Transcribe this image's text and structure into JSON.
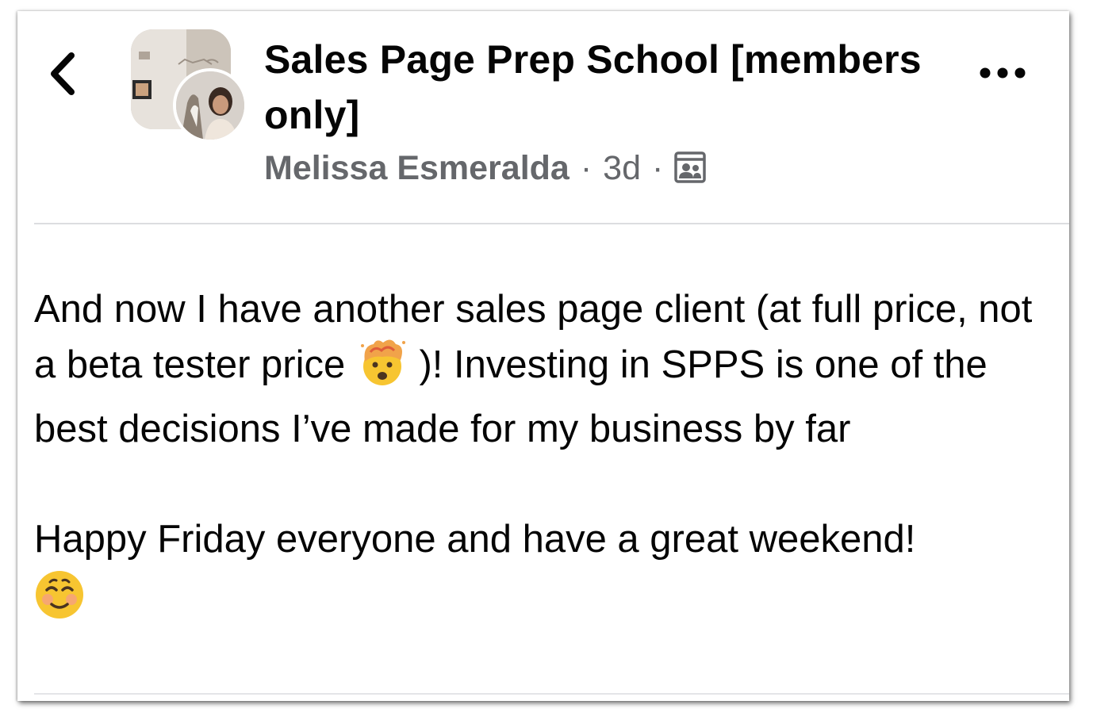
{
  "header": {
    "group_name": "Sales Page Prep School [members only]",
    "author": "Melissa Esmeralda",
    "separator": "·",
    "time_ago": "3d",
    "privacy_icon": "group-members-icon"
  },
  "navigation": {
    "back_icon": "chevron-left-icon",
    "more_icon": "more-options-icon"
  },
  "post": {
    "para1_part1": "And now I have another sales page client (at full price, not a beta tester price",
    "para1_emoji": "exploding-head-emoji",
    "para1_part2": ")! Investing in SPPS is one of the best decisions I’ve made for my business by far",
    "para2_text": "Happy Friday everyone and have a great weekend!",
    "para2_emoji": "smiling-face-emoji"
  },
  "colors": {
    "primary_text": "#050505",
    "secondary_text": "#65676b",
    "divider": "#dcdde0"
  }
}
